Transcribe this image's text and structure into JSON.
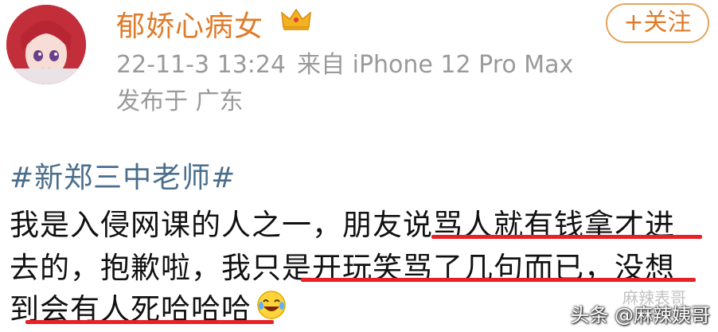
{
  "post_header": {
    "username": "郁娇心病女",
    "follow_label": "+关注",
    "date_time": "22-11-3 13:24",
    "source": "来自 iPhone 12 Pro Max",
    "location": "发布于 广东"
  },
  "post_body": {
    "hashtag": "#新郑三中老师#",
    "lines": [
      "我是入侵网课的人之一，朋友说骂人就有钱拿才进",
      "去的，抱歉啦，我只是开玩笑骂了几句而已，没想",
      "到会有人死哈哈哈"
    ]
  },
  "watermark": {
    "main": "头条 @麻辣姨哥",
    "faint": "麻辣表哥"
  },
  "colors": {
    "username": "#e07b2a",
    "hashtag": "#4b6e8c",
    "underline": "#e82127",
    "meta": "#9a9a9a"
  },
  "icons": [
    "avatar",
    "crown-icon",
    "laughing-crying-emoji-icon"
  ]
}
